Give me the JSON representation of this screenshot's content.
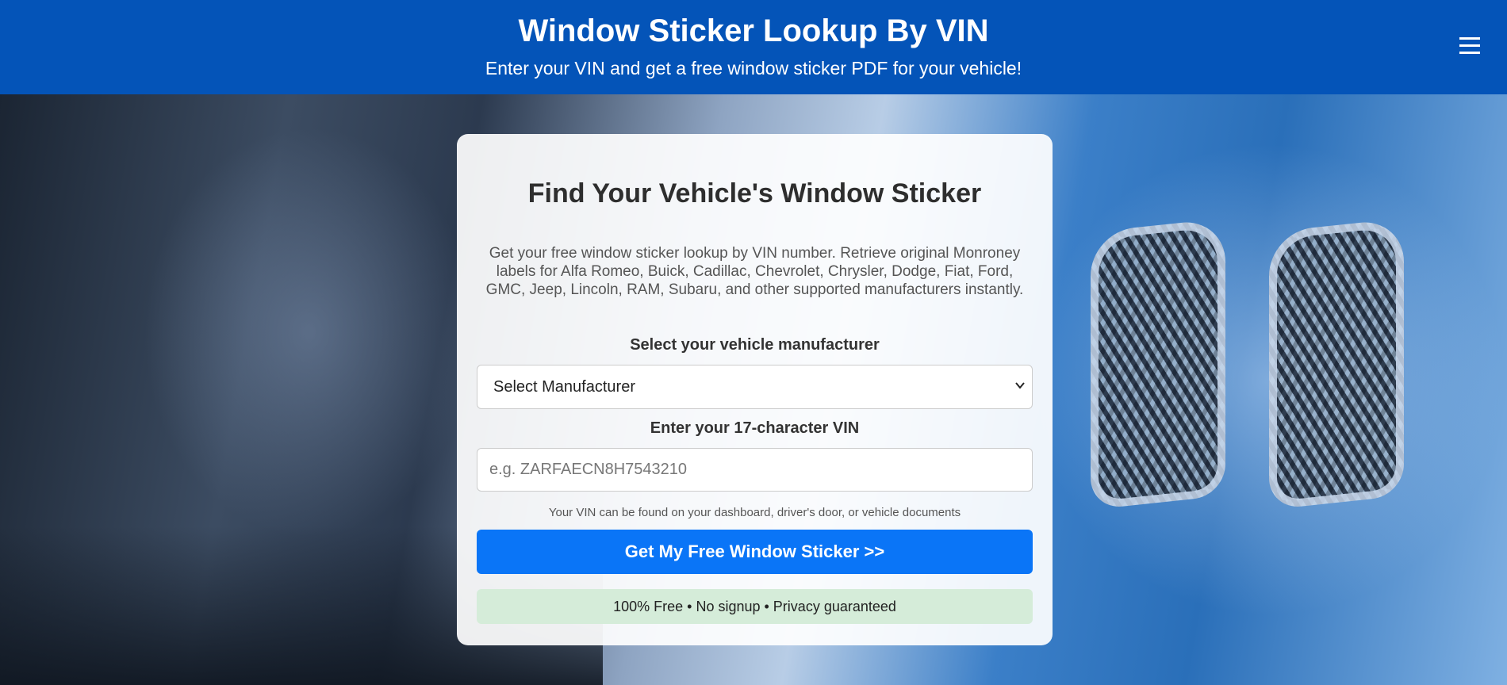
{
  "header": {
    "title": "Window Sticker Lookup By VIN",
    "subtitle": "Enter your VIN and get a free window sticker PDF for your vehicle!",
    "menu_icon": "hamburger-menu-icon"
  },
  "card": {
    "title": "Find Your Vehicle's Window Sticker",
    "description": "Get your free window sticker lookup by VIN number. Retrieve original Monroney labels for Alfa Romeo, Buick, Cadillac, Chevrolet, Chrysler, Dodge, Fiat, Ford, GMC, Jeep, Lincoln, RAM, Subaru, and other supported manufacturers instantly.",
    "manufacturer_label": "Select your vehicle manufacturer",
    "manufacturer_selected": "Select Manufacturer",
    "vin_label": "Enter your 17-character VIN",
    "vin_value": "",
    "vin_placeholder": "e.g. ZARFAECN8H7543210",
    "hint": "Your VIN can be found on your dashboard, driver's door, or vehicle documents",
    "submit_label": "Get My Free Window Sticker >>",
    "notice": "100% Free • No signup • Privacy guaranteed"
  },
  "colors": {
    "header_bg": "#0454b8",
    "button_bg": "#0a75f7",
    "notice_bg": "#d5ecd9"
  }
}
